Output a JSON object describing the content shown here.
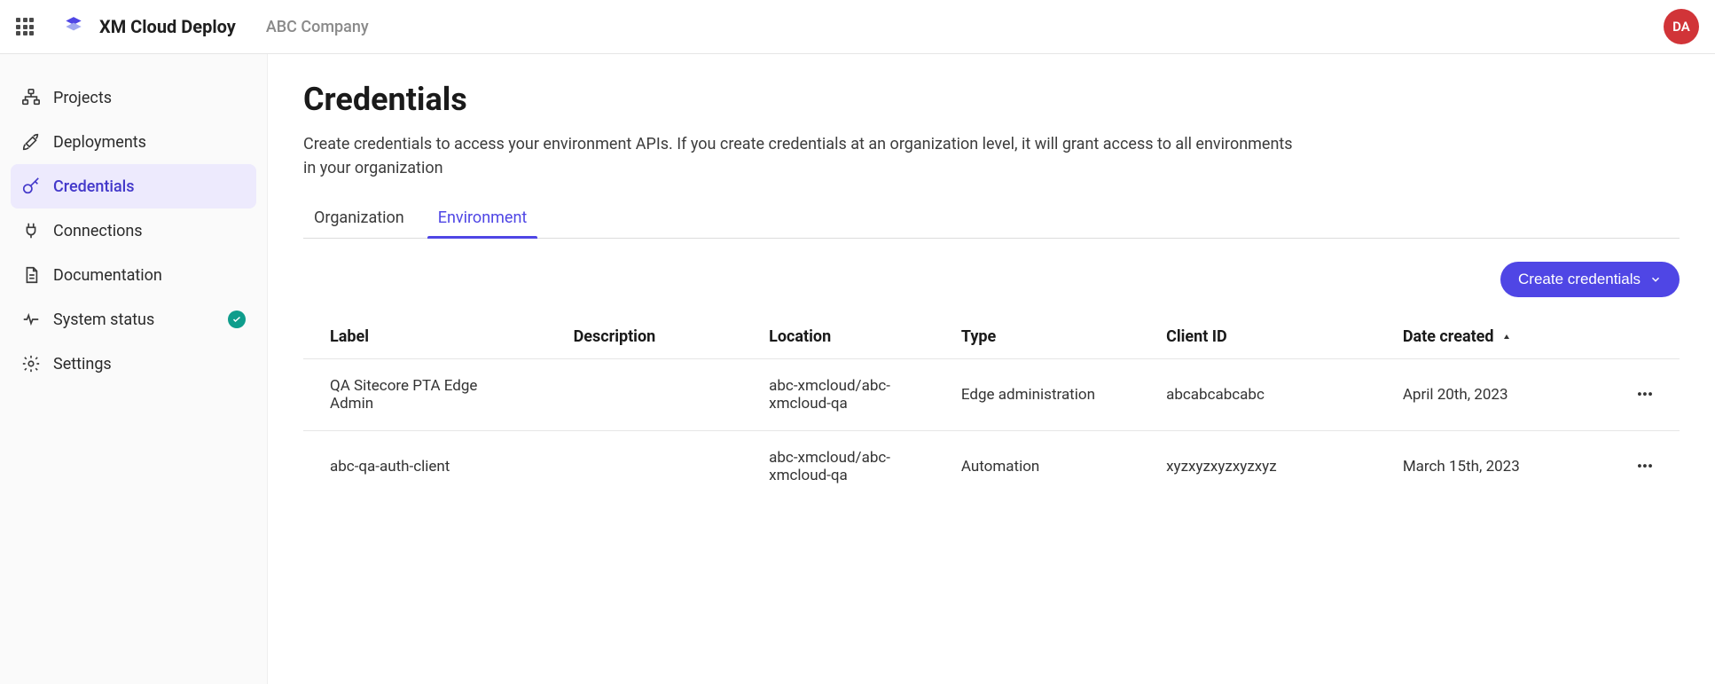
{
  "header": {
    "brand": "XM Cloud Deploy",
    "company": "ABC Company",
    "avatar_initials": "DA"
  },
  "sidebar": {
    "items": [
      {
        "label": "Projects"
      },
      {
        "label": "Deployments"
      },
      {
        "label": "Credentials"
      },
      {
        "label": "Connections"
      },
      {
        "label": "Documentation"
      },
      {
        "label": "System status"
      },
      {
        "label": "Settings"
      }
    ]
  },
  "page": {
    "title": "Credentials",
    "subtitle": "Create credentials to access your environment APIs. If you create credentials at an organization level, it will grant access to all environments in your organization"
  },
  "tabs": [
    {
      "label": "Organization"
    },
    {
      "label": "Environment"
    }
  ],
  "actions": {
    "create_button": "Create credentials"
  },
  "table": {
    "headers": {
      "label": "Label",
      "description": "Description",
      "location": "Location",
      "type": "Type",
      "client_id": "Client ID",
      "date_created": "Date created"
    },
    "rows": [
      {
        "label": "QA Sitecore PTA Edge Admin",
        "description": "",
        "location": "abc-xmcloud/abc-xmcloud-qa",
        "type": "Edge administration",
        "client_id": "abcabcabcabc",
        "date_created": "April 20th, 2023"
      },
      {
        "label": "abc-qa-auth-client",
        "description": "",
        "location": "abc-xmcloud/abc-xmcloud-qa",
        "type": "Automation",
        "client_id": "xyzxyzxyzxyzxyz",
        "date_created": "March 15th, 2023"
      }
    ]
  }
}
